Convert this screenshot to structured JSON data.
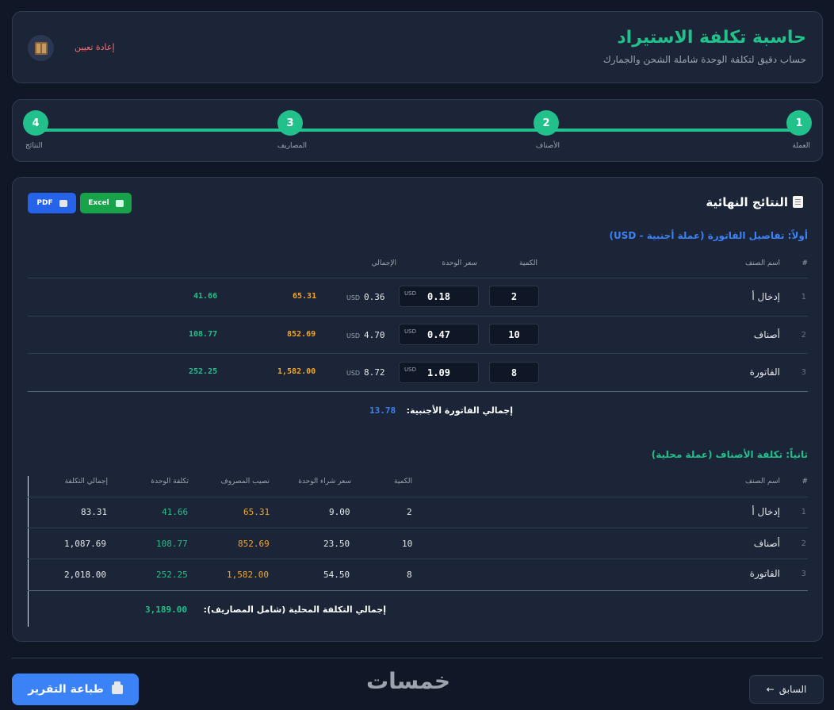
{
  "header": {
    "title": "حاسبة تكلفة الاستيراد",
    "subtitle": "حساب دقيق لتكلفة الوحدة شاملة الشحن والجمارك",
    "reset_label": "إعادة تعيين"
  },
  "stepper": {
    "steps": [
      {
        "number": "1",
        "label": "العملة"
      },
      {
        "number": "2",
        "label": "الأصناف"
      },
      {
        "number": "3",
        "label": "المصاريف"
      },
      {
        "number": "4",
        "label": "النتائج"
      }
    ]
  },
  "results": {
    "title": "النتائج النهائية",
    "pdf_label": "PDF",
    "excel_label": "Excel",
    "invoice": {
      "title": "أولاً: تفاصيل الفاتورة (عملة أجنبية - USD)",
      "headers": {
        "index": "#",
        "name": "اسم الصنف",
        "qty": "الكمية",
        "unit_price": "سعر الوحدة",
        "total": "الإجمالي"
      },
      "currency": "USD",
      "rows": [
        {
          "index": "1",
          "name": "إدخال أ",
          "qty": "2",
          "price": "0.18",
          "total": "0.36",
          "share": "65.31",
          "unit_cost": "41.66"
        },
        {
          "index": "2",
          "name": "أصناف",
          "qty": "10",
          "price": "0.47",
          "total": "4.70",
          "share": "852.69",
          "unit_cost": "108.77"
        },
        {
          "index": "3",
          "name": "الفاتورة",
          "qty": "8",
          "price": "1.09",
          "total": "8.72",
          "share": "1,582.00",
          "unit_cost": "252.25"
        }
      ],
      "total_label": "إجمالي الفاتورة الأجنبية:",
      "total_value": "13.78"
    },
    "local": {
      "title": "ثانياً: تكلفة الأصناف (عملة محلية)",
      "headers": {
        "index": "#",
        "name": "اسم الصنف",
        "qty": "الكمية",
        "purchase_price": "سعر شراء الوحدة",
        "expense_share": "نصيب المصروف",
        "unit_cost": "تكلفة الوحدة",
        "total_cost": "إجمالي التكلفة"
      },
      "rows": [
        {
          "index": "1",
          "name": "إدخال أ",
          "qty": "2",
          "purchase": "9.00",
          "share": "65.31",
          "unit_cost": "41.66",
          "total": "83.31"
        },
        {
          "index": "2",
          "name": "أصناف",
          "qty": "10",
          "purchase": "23.50",
          "share": "852.69",
          "unit_cost": "108.77",
          "total": "1,087.69"
        },
        {
          "index": "3",
          "name": "الفاتورة",
          "qty": "8",
          "purchase": "54.50",
          "share": "1,582.00",
          "unit_cost": "252.25",
          "total": "2,018.00"
        }
      ],
      "total_label": "إجمالي التكلفة المحلية (شامل المصاريف):",
      "total_value": "3,189.00"
    }
  },
  "footer": {
    "print_label": "طباعة التقرير",
    "brand": "خمسات",
    "prev_label": "السابق",
    "prev_arrow": "←"
  },
  "colors": {
    "accent_green": "#22c08a",
    "accent_blue": "#3b82f6",
    "accent_orange": "#f5a623",
    "danger": "#f87171",
    "background": "#101827"
  }
}
